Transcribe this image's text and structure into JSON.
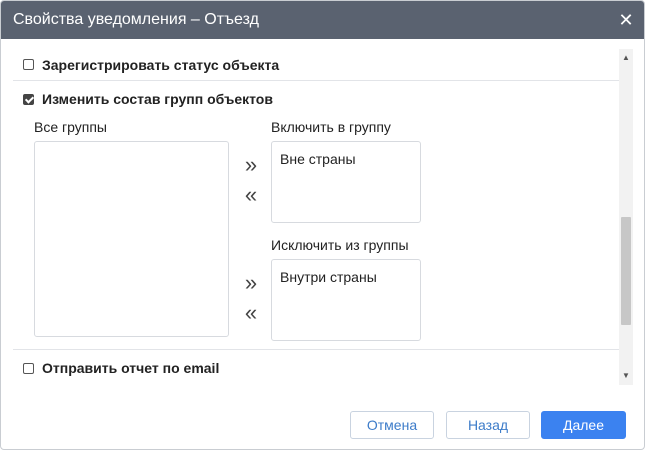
{
  "dialog": {
    "title": "Свойства уведомления – Отъезд",
    "close_glyph": "✕"
  },
  "options": {
    "register_status": {
      "label": "Зарегистрировать статус объекта",
      "checked": false
    },
    "change_groups": {
      "label": "Изменить состав групп объектов",
      "checked": true
    },
    "send_report": {
      "label": "Отправить отчет по email",
      "checked": false
    }
  },
  "groups": {
    "all_label": "Все группы",
    "all_items": [],
    "include_label": "Включить в группу",
    "include_items": [
      "Вне страны"
    ],
    "exclude_label": "Исключить из группы",
    "exclude_items": [
      "Внутри страны"
    ],
    "move_right_glyph": "»",
    "move_left_glyph": "«"
  },
  "footer": {
    "cancel_label": "Отмена",
    "back_label": "Назад",
    "next_label": "Далее"
  },
  "colors": {
    "titlebar": "#5a6270",
    "primary": "#3b82f0",
    "link_text": "#3d7cc9"
  }
}
